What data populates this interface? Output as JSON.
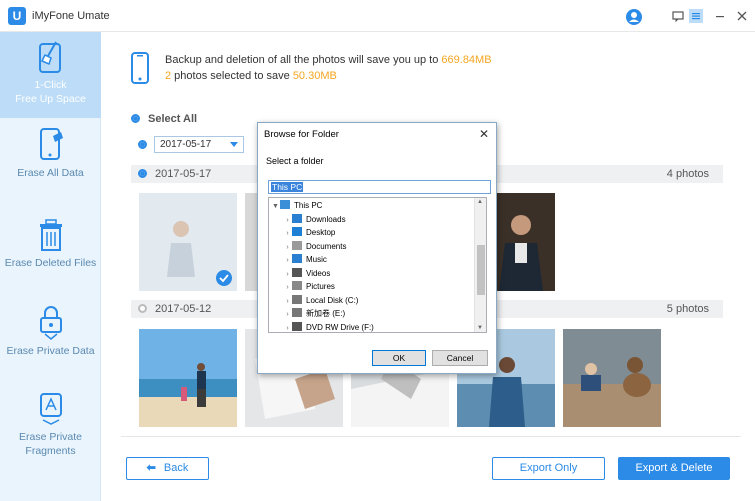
{
  "app": {
    "title": "iMyFone Umate",
    "logo_letter": "U"
  },
  "titlebar": {
    "icons": [
      "user-icon",
      "feedback-icon",
      "menu-icon",
      "minimize-icon",
      "close-icon"
    ]
  },
  "sidebar": {
    "items": [
      {
        "label_line1": "1-Click",
        "label_line2": "Free Up Space",
        "icon": "broom-icon",
        "active": true
      },
      {
        "label_line1": "Erase All Data",
        "label_line2": "",
        "icon": "phone-erase-icon"
      },
      {
        "label_line1": "Erase Deleted Files",
        "label_line2": "",
        "icon": "trash-icon"
      },
      {
        "label_line1": "Erase Private Data",
        "label_line2": "",
        "icon": "lock-icon"
      },
      {
        "label_line1": "Erase Private",
        "label_line2": "Fragments",
        "icon": "app-fragments-icon"
      }
    ]
  },
  "summary": {
    "line1_prefix": "Backup and deletion of all the photos will save you up to ",
    "line1_value": "669.84MB",
    "line2_count": "2",
    "line2_text": " photos selected to save ",
    "line2_value": "50.30MB"
  },
  "select_all_label": "Select All",
  "date_filter": {
    "value": "2017-05-17"
  },
  "groups": [
    {
      "date": "2017-05-17",
      "count": "4 photos"
    },
    {
      "date": "2017-05-12",
      "count": "5 photos"
    }
  ],
  "buttons": {
    "back": "Back",
    "export_only": "Export Only",
    "export_delete": "Export & Delete"
  },
  "dialog": {
    "title": "Browse for Folder",
    "subtitle": "Select a folder",
    "input_value": "This PC",
    "tree": [
      {
        "label": "This PC",
        "level": 0,
        "arrow": "▼",
        "icon": "computer-icon"
      },
      {
        "label": "Downloads",
        "level": 1,
        "arrow": "›",
        "icon": "download-icon"
      },
      {
        "label": "Desktop",
        "level": 1,
        "arrow": "›",
        "icon": "desktop-icon"
      },
      {
        "label": "Documents",
        "level": 1,
        "arrow": "›",
        "icon": "documents-icon"
      },
      {
        "label": "Music",
        "level": 1,
        "arrow": "›",
        "icon": "music-icon"
      },
      {
        "label": "Videos",
        "level": 1,
        "arrow": "›",
        "icon": "videos-icon"
      },
      {
        "label": "Pictures",
        "level": 1,
        "arrow": "›",
        "icon": "pictures-icon"
      },
      {
        "label": "Local Disk (C:)",
        "level": 1,
        "arrow": "›",
        "icon": "disk-icon"
      },
      {
        "label": "新加卷 (E:)",
        "level": 1,
        "arrow": "›",
        "icon": "disk-icon"
      },
      {
        "label": "DVD RW Drive (F:)",
        "level": 1,
        "arrow": "›",
        "icon": "dvd-icon"
      }
    ],
    "ok_label": "OK",
    "cancel_label": "Cancel"
  },
  "colors": {
    "accent": "#2b8be6",
    "highlight": "#f5a623",
    "sidebar_bg": "#e9f4fd"
  }
}
